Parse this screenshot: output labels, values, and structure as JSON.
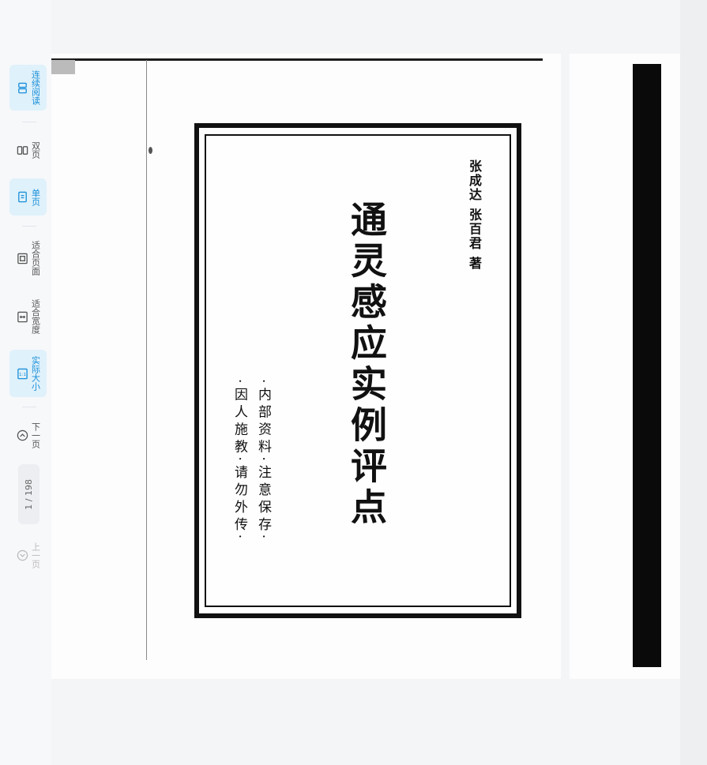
{
  "toolbar": {
    "tools": [
      {
        "id": "continuous",
        "label": "连续阅读",
        "icon": "continuous-pages-icon",
        "active": true
      },
      {
        "id": "double",
        "label": "双页",
        "icon": "double-page-icon",
        "active": false
      },
      {
        "id": "single",
        "label": "单页",
        "icon": "single-page-icon",
        "active": true
      },
      {
        "id": "fit-page",
        "label": "适合页面",
        "icon": "fit-page-icon",
        "active": false
      },
      {
        "id": "fit-width",
        "label": "适合宽度",
        "icon": "fit-width-icon",
        "active": false
      },
      {
        "id": "actual-size",
        "label": "实际大小",
        "icon": "actual-size-icon",
        "active": true
      },
      {
        "id": "next-page",
        "label": "下一页",
        "icon": "chevron-up-circle-icon",
        "active": false
      },
      {
        "id": "prev-page",
        "label": "上一页",
        "icon": "chevron-down-circle-icon",
        "active": false
      }
    ],
    "pager": {
      "current": "1",
      "total": "198",
      "display": "1 / 198"
    },
    "accent_color": "#1a8fd8",
    "active_bg": "#dff1fb"
  },
  "document": {
    "page1": {
      "authors": "张成达  张百君 著",
      "title": "通灵感应实例评点",
      "note_line1": "·内部资料·注意保存·",
      "note_line2": "·因人施教·请勿外传·"
    }
  }
}
